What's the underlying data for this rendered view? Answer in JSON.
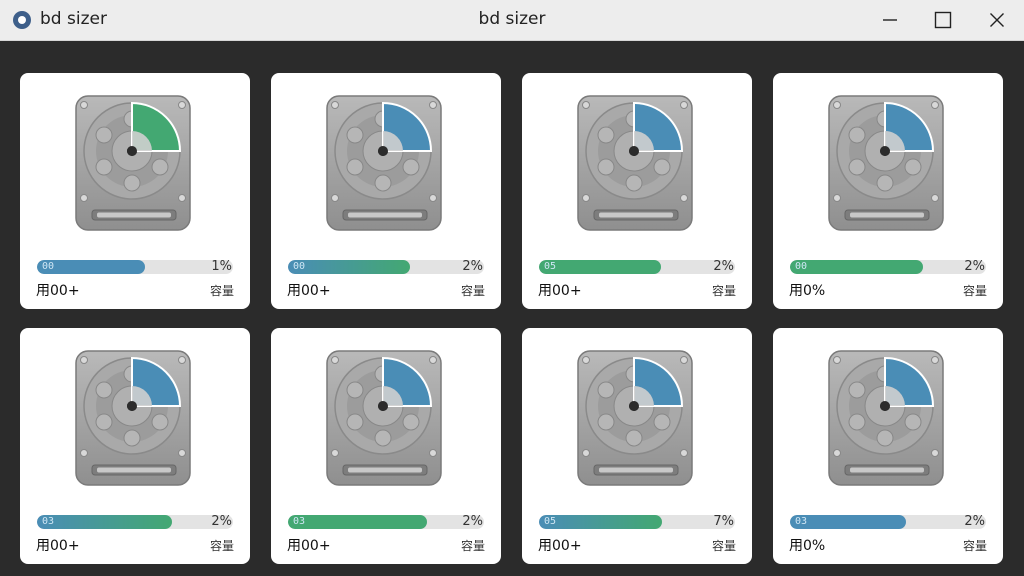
{
  "window": {
    "app_name": "bd sizer",
    "title": "bd sizer",
    "app_icon": "gear-disk-icon",
    "controls": [
      "minimize-icon",
      "maximize-icon",
      "close-icon"
    ]
  },
  "colors": {
    "green": "#43a872",
    "blue": "#4a8db6",
    "track": "#e3e3e3"
  },
  "disks": [
    {
      "bar_label": "00",
      "percent": "1%",
      "used_label": "用00+",
      "capacity_label": "容量",
      "fill": 0.55,
      "gradient": [
        "#4a8db6",
        "#4a8db6"
      ],
      "sector_color": "#43a872"
    },
    {
      "bar_label": "00",
      "percent": "2%",
      "used_label": "用00+",
      "capacity_label": "容量",
      "fill": 0.62,
      "gradient": [
        "#4a8db6",
        "#43a872"
      ],
      "sector_color": "#4a8db6"
    },
    {
      "bar_label": "05",
      "percent": "2%",
      "used_label": "用00+",
      "capacity_label": "容量",
      "fill": 0.62,
      "gradient": [
        "#43a872",
        "#43a872"
      ],
      "sector_color": "#4a8db6"
    },
    {
      "bar_label": "00",
      "percent": "2%",
      "used_label": "用0%",
      "capacity_label": "容量",
      "fill": 0.68,
      "gradient": [
        "#43a872",
        "#43a872"
      ],
      "sector_color": "#4a8db6"
    },
    {
      "bar_label": "03",
      "percent": "2%",
      "used_label": "用00+",
      "capacity_label": "容量",
      "fill": 0.69,
      "gradient": [
        "#4a8db6",
        "#43a872"
      ],
      "sector_color": "#4a8db6"
    },
    {
      "bar_label": "03",
      "percent": "2%",
      "used_label": "用00+",
      "capacity_label": "容量",
      "fill": 0.71,
      "gradient": [
        "#43a872",
        "#43a872"
      ],
      "sector_color": "#4a8db6"
    },
    {
      "bar_label": "05",
      "percent": "7%",
      "used_label": "用00+",
      "capacity_label": "容量",
      "fill": 0.63,
      "gradient": [
        "#4a8db6",
        "#43a872"
      ],
      "sector_color": "#4a8db6"
    },
    {
      "bar_label": "03",
      "percent": "2%",
      "used_label": "用0%",
      "capacity_label": "容量",
      "fill": 0.59,
      "gradient": [
        "#4a8db6",
        "#4a8db6"
      ],
      "sector_color": "#4a8db6"
    }
  ]
}
